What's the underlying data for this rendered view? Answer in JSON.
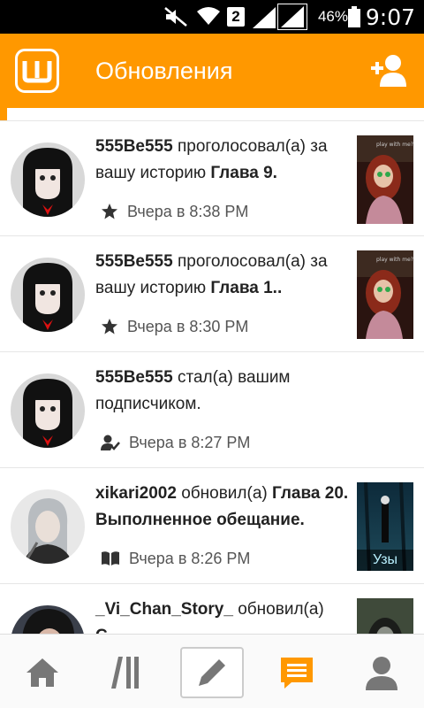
{
  "status_bar": {
    "battery_percent": "46%",
    "time": "9:07",
    "sim_label": "2",
    "icons": [
      "mute-icon",
      "wifi-icon",
      "signal-icon",
      "signal-icon",
      "battery-icon"
    ]
  },
  "app_bar": {
    "title": "Обновления",
    "logo_icon": "wattpad-logo-icon",
    "action_icon": "add-user-icon",
    "color": "#ff9800"
  },
  "feed": [
    {
      "user": "555Be555",
      "action": " проголосовал(а) за вашу историю ",
      "target": "Глава 9.",
      "time": "Вчера в 8:38 PM",
      "meta_icon": "star-icon",
      "has_cover": true
    },
    {
      "user": "555Be555",
      "action": " проголосовал(а) за вашу историю ",
      "target": "Глава 1..",
      "time": "Вчера в 8:30 PM",
      "meta_icon": "star-icon",
      "has_cover": true
    },
    {
      "user": "555Be555",
      "action": " стал(а) вашим подписчиком.",
      "target": "",
      "time": "Вчера в 8:27 PM",
      "meta_icon": "follower-icon",
      "has_cover": false
    },
    {
      "user": "xikari2002",
      "action": " обновил(а) ",
      "target": "Глава 20. Выполненное обещание.",
      "time": "Вчера в 8:26 PM",
      "meta_icon": "book-icon",
      "has_cover": true,
      "cover_label": "Узы"
    },
    {
      "user": "_Vi_Chan_Story_",
      "action": " обновил(а) ",
      "target": "С...",
      "time": "",
      "meta_icon": "book-icon",
      "has_cover": true
    }
  ],
  "bottom_nav": {
    "items": [
      "home-icon",
      "library-icon",
      "write-icon",
      "messages-icon",
      "profile-icon"
    ],
    "active": "messages-icon",
    "active_color": "#ff9800",
    "inactive_color": "#777777"
  }
}
